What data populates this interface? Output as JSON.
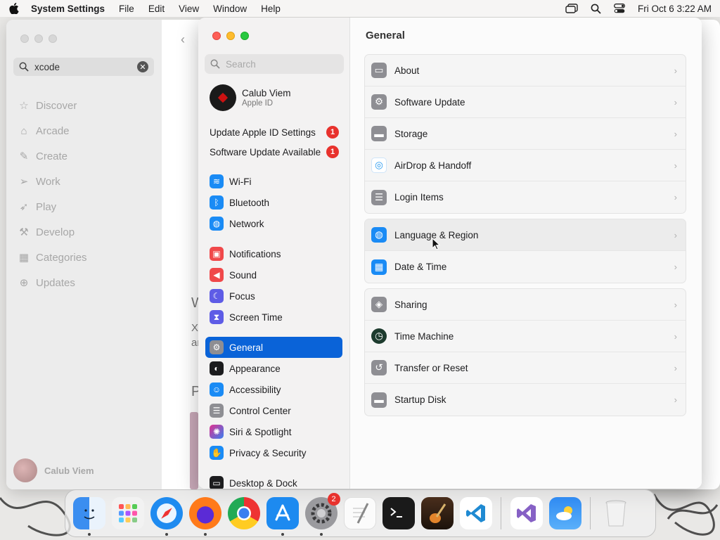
{
  "menubar": {
    "app_name": "System Settings",
    "menus": [
      "File",
      "Edit",
      "View",
      "Window",
      "Help"
    ],
    "clock": "Fri Oct 6  3:22 AM"
  },
  "appstore": {
    "search_value": "xcode",
    "nav": [
      {
        "label": "Discover",
        "icon": "star-icon"
      },
      {
        "label": "Arcade",
        "icon": "joystick-icon"
      },
      {
        "label": "Create",
        "icon": "paintbrush-icon"
      },
      {
        "label": "Work",
        "icon": "paperplane-icon"
      },
      {
        "label": "Play",
        "icon": "rocket-icon"
      },
      {
        "label": "Develop",
        "icon": "hammer-icon"
      },
      {
        "label": "Categories",
        "icon": "grid-icon"
      },
      {
        "label": "Updates",
        "icon": "download-icon"
      }
    ],
    "user": "Calub Viem",
    "fragments": [
      "W",
      "X",
      "ar",
      "P"
    ]
  },
  "settings": {
    "search_placeholder": "Search",
    "account": {
      "name": "Calub Viem",
      "subtitle": "Apple ID"
    },
    "alerts": [
      {
        "label": "Update Apple ID Settings",
        "count": "1"
      },
      {
        "label": "Software Update Available",
        "count": "1"
      }
    ],
    "sidebar": [
      {
        "label": "Wi-Fi",
        "color": "#1a8bf5"
      },
      {
        "label": "Bluetooth",
        "color": "#1a8bf5"
      },
      {
        "label": "Network",
        "color": "#1a8bf5"
      },
      {
        "label": "Notifications",
        "color": "#f0484a"
      },
      {
        "label": "Sound",
        "color": "#f0484a"
      },
      {
        "label": "Focus",
        "color": "#5e5ce6"
      },
      {
        "label": "Screen Time",
        "color": "#5e5ce6"
      },
      {
        "label": "General",
        "color": "#8e8e93"
      },
      {
        "label": "Appearance",
        "color": "#1c1c1e"
      },
      {
        "label": "Accessibility",
        "color": "#1a8bf5"
      },
      {
        "label": "Control Center",
        "color": "#8e8e93"
      },
      {
        "label": "Siri & Spotlight",
        "color": "#a12fd6"
      },
      {
        "label": "Privacy & Security",
        "color": "#1a8bf5"
      },
      {
        "label": "Desktop & Dock",
        "color": "#1c1c1e"
      }
    ],
    "title": "General",
    "groups": [
      [
        {
          "label": "About",
          "color": "#8e8e93"
        },
        {
          "label": "Software Update",
          "color": "#8e8e93"
        },
        {
          "label": "Storage",
          "color": "#8e8e93"
        },
        {
          "label": "AirDrop & Handoff",
          "color": "#2a9bf0"
        },
        {
          "label": "Login Items",
          "color": "#8e8e93"
        }
      ],
      [
        {
          "label": "Language & Region",
          "color": "#1a8bf5"
        },
        {
          "label": "Date & Time",
          "color": "#1a8bf5"
        }
      ],
      [
        {
          "label": "Sharing",
          "color": "#8e8e93"
        },
        {
          "label": "Time Machine",
          "color": "#2b8a5c"
        },
        {
          "label": "Transfer or Reset",
          "color": "#8e8e93"
        },
        {
          "label": "Startup Disk",
          "color": "#8e8e93"
        }
      ]
    ]
  },
  "dock": {
    "apps": [
      "Finder",
      "Launchpad",
      "Safari",
      "Firefox",
      "Chrome",
      "App Store",
      "System Settings",
      "TextEdit",
      "Terminal",
      "GarageBand",
      "Visual Studio Code",
      "Visual Studio",
      "Weather",
      "Trash"
    ],
    "settings_badge": "2"
  }
}
